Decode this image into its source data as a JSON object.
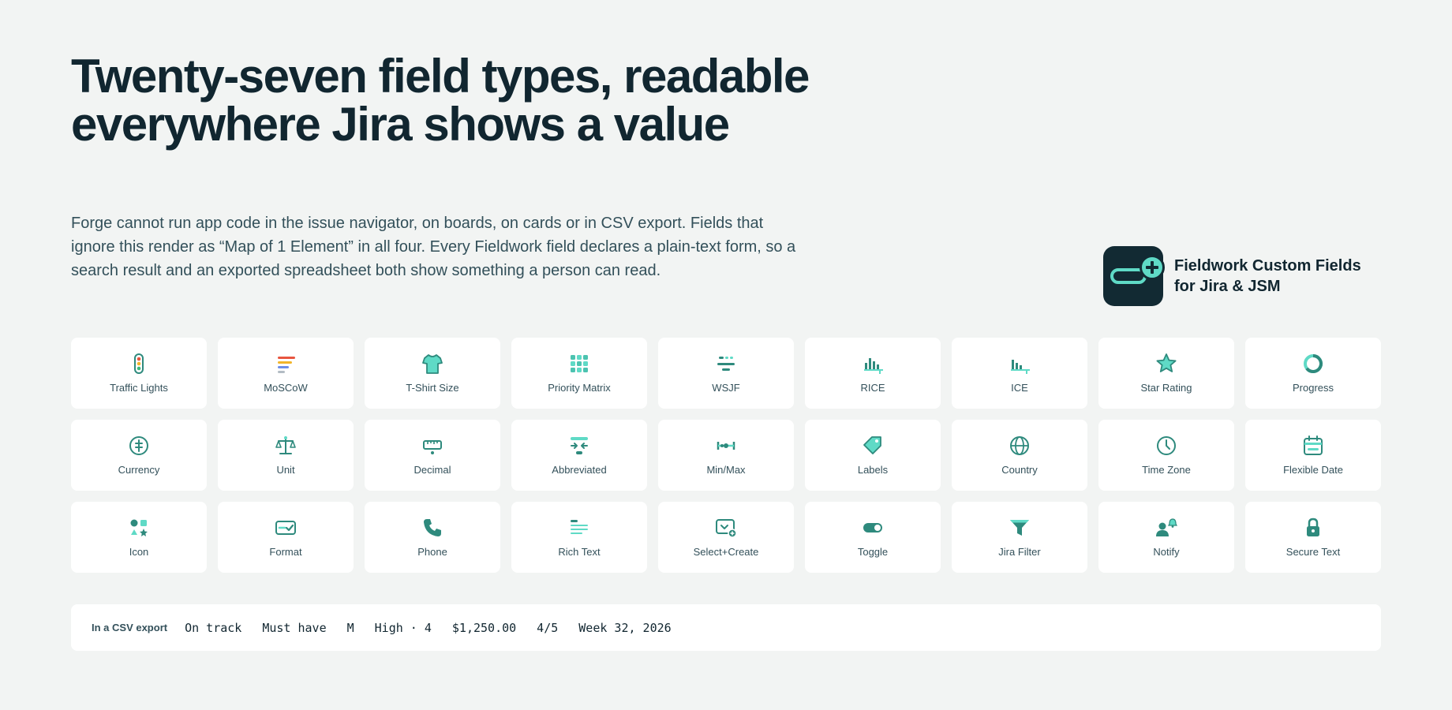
{
  "headline": "Twenty-seven field types, readable everywhere Jira shows a value",
  "lede": "Forge cannot run app code in the issue navigator, on boards, on cards or in CSV export. Fields that ignore this render as “Map of 1 Element” in all four. Every Fieldwork field declares a plain-text form, so a search result and an exported spreadsheet both show something a person can read.",
  "brand": {
    "name": "Fieldwork Custom Fields for Jira & JSM",
    "logo_icon": "pill-plus-logo"
  },
  "colors": {
    "accent": "#5fdac6",
    "accent_dark": "#2e8a7d",
    "ink": "#112630",
    "bg": "#f2f4f3"
  },
  "field_types": [
    {
      "label": "Traffic Lights",
      "icon": "traffic-lights-icon"
    },
    {
      "label": "MoSCoW",
      "icon": "moscow-bars-icon"
    },
    {
      "label": "T-Shirt Size",
      "icon": "tshirt-icon"
    },
    {
      "label": "Priority Matrix",
      "icon": "matrix-grid-icon"
    },
    {
      "label": "WSJF",
      "icon": "wsjf-icon"
    },
    {
      "label": "RICE",
      "icon": "rice-chart-icon"
    },
    {
      "label": "ICE",
      "icon": "ice-chart-icon"
    },
    {
      "label": "Star Rating",
      "icon": "star-icon"
    },
    {
      "label": "Progress",
      "icon": "progress-ring-icon"
    },
    {
      "label": "Currency",
      "icon": "currency-icon"
    },
    {
      "label": "Unit",
      "icon": "scale-icon"
    },
    {
      "label": "Decimal",
      "icon": "ruler-icon"
    },
    {
      "label": "Abbreviated",
      "icon": "compress-icon"
    },
    {
      "label": "Min/Max",
      "icon": "range-icon"
    },
    {
      "label": "Labels",
      "icon": "tag-icon"
    },
    {
      "label": "Country",
      "icon": "globe-icon"
    },
    {
      "label": "Time Zone",
      "icon": "clock-icon"
    },
    {
      "label": "Flexible Date",
      "icon": "calendar-icon"
    },
    {
      "label": "Icon",
      "icon": "shapes-icon"
    },
    {
      "label": "Format",
      "icon": "format-check-icon"
    },
    {
      "label": "Phone",
      "icon": "phone-icon"
    },
    {
      "label": "Rich Text",
      "icon": "rich-text-icon"
    },
    {
      "label": "Select+Create",
      "icon": "select-create-icon"
    },
    {
      "label": "Toggle",
      "icon": "toggle-icon"
    },
    {
      "label": "Jira Filter",
      "icon": "filter-icon"
    },
    {
      "label": "Notify",
      "icon": "notify-user-icon"
    },
    {
      "label": "Secure Text",
      "icon": "lock-icon"
    }
  ],
  "csv_export": {
    "label": "In a CSV export",
    "values": [
      "On track",
      "Must have",
      "M",
      "High · 4",
      "$1,250.00",
      "4/5",
      "Week 32, 2026"
    ]
  }
}
